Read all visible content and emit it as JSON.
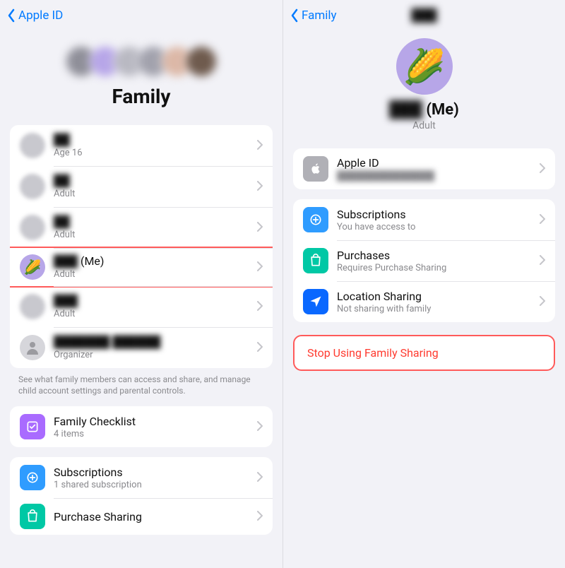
{
  "left": {
    "back_label": "Apple ID",
    "title": "Family",
    "members": [
      {
        "name": "██",
        "role": "Age 16"
      },
      {
        "name": "██",
        "role": "Adult"
      },
      {
        "name": "██",
        "role": "Adult"
      },
      {
        "name": "███",
        "me_suffix": " (Me)",
        "role": "Adult",
        "highlight": true
      },
      {
        "name": "███",
        "role": "Adult"
      },
      {
        "name": "███████ ██████",
        "role": "Organizer"
      }
    ],
    "footer_note": "See what family members can access and share, and manage child account settings and parental controls.",
    "checklist": {
      "title": "Family Checklist",
      "sub": "4 items"
    },
    "services": {
      "subscriptions": {
        "title": "Subscriptions",
        "sub": "1 shared subscription"
      },
      "purchase_sharing": {
        "title": "Purchase Sharing"
      }
    }
  },
  "right": {
    "back_label": "Family",
    "nav_title": "███",
    "member": {
      "name": "███",
      "me_suffix": " (Me)",
      "role": "Adult",
      "emoji": "🌽"
    },
    "apple_id": {
      "title": "Apple ID",
      "sub": "███████████████"
    },
    "services": {
      "subscriptions": {
        "title": "Subscriptions",
        "sub": "You have access to"
      },
      "purchases": {
        "title": "Purchases",
        "sub": "Requires Purchase Sharing"
      },
      "location": {
        "title": "Location Sharing",
        "sub": "Not sharing with family"
      }
    },
    "stop_action": "Stop Using Family Sharing"
  }
}
